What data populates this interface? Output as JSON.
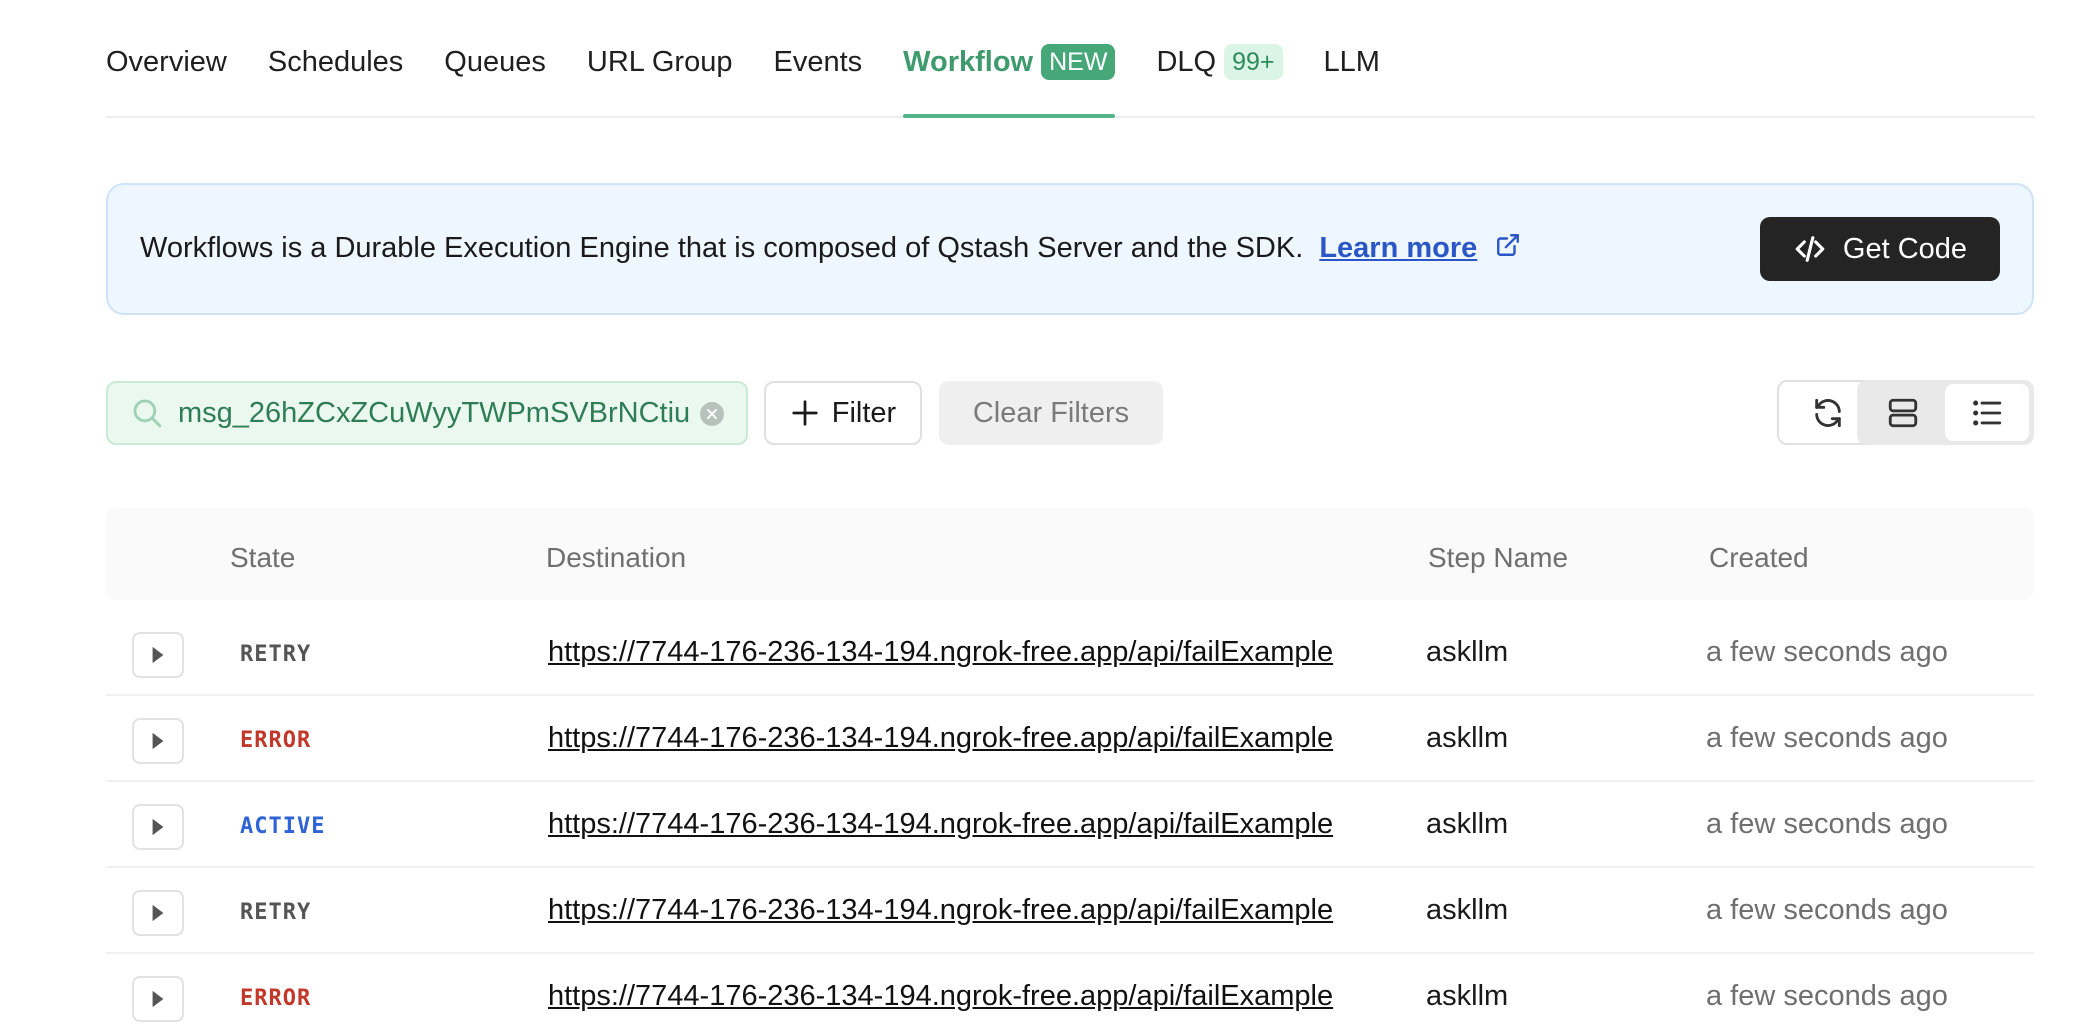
{
  "tabs": [
    {
      "label": "Overview"
    },
    {
      "label": "Schedules"
    },
    {
      "label": "Queues"
    },
    {
      "label": "URL Group"
    },
    {
      "label": "Events"
    },
    {
      "label": "Workflow",
      "badge": "NEW"
    },
    {
      "label": "DLQ",
      "badge": "99+"
    },
    {
      "label": "LLM"
    }
  ],
  "banner": {
    "text": "Workflows is a Durable Execution Engine that is composed of Qstash Server and the SDK.",
    "link_label": "Learn more",
    "button_label": "Get Code"
  },
  "toolbar": {
    "search_value": "msg_26hZCxZCuWyyTWPmSVBrNCtiu",
    "filter_label": "Filter",
    "clear_label": "Clear Filters"
  },
  "table": {
    "headers": {
      "state": "State",
      "destination": "Destination",
      "step_name": "Step Name",
      "created": "Created"
    },
    "rows": [
      {
        "state": "RETRY",
        "destination": "https://7744-176-236-134-194.ngrok-free.app/api/failExample",
        "step_name": "askllm",
        "created": "a few seconds ago"
      },
      {
        "state": "ERROR",
        "destination": "https://7744-176-236-134-194.ngrok-free.app/api/failExample",
        "step_name": "askllm",
        "created": "a few seconds ago"
      },
      {
        "state": "ACTIVE",
        "destination": "https://7744-176-236-134-194.ngrok-free.app/api/failExample",
        "step_name": "askllm",
        "created": "a few seconds ago"
      },
      {
        "state": "RETRY",
        "destination": "https://7744-176-236-134-194.ngrok-free.app/api/failExample",
        "step_name": "askllm",
        "created": "a few seconds ago"
      },
      {
        "state": "ERROR",
        "destination": "https://7744-176-236-134-194.ngrok-free.app/api/failExample",
        "step_name": "askllm",
        "created": "a few seconds ago"
      }
    ]
  },
  "colors": {
    "accent": "#52b58a",
    "retry": "#555555",
    "error": "#c0392b",
    "active": "#2f63d6",
    "link": "#2b56c6"
  },
  "icons": {
    "search": "search-icon",
    "clear": "clear-circle-icon",
    "filter": "plus-icon",
    "refresh": "refresh-icon",
    "external": "external-link-icon",
    "code": "code-icon",
    "expand": "caret-right-icon",
    "view_card": "card-view-icon",
    "view_list": "list-view-icon"
  }
}
